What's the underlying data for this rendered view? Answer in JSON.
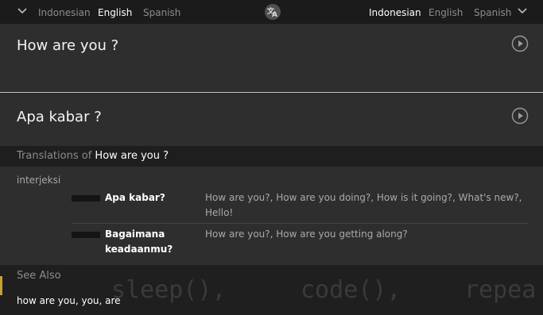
{
  "source_languages": [
    "Indonesian",
    "English",
    "Spanish"
  ],
  "source_active": "English",
  "target_languages": [
    "Indonesian",
    "English",
    "Spanish"
  ],
  "target_active": "Indonesian",
  "source_phrase": "How are you ?",
  "target_phrase": "Apa kabar ?",
  "translations_header": {
    "prefix": "Translations of",
    "term": "How are you ?"
  },
  "part_of_speech": "interjeksi",
  "translations": [
    {
      "word": "Apa kabar?",
      "synonyms": "How are you?, How are you doing?, How is it going?, What's new?, Hello!"
    },
    {
      "word": "Bagaimana keadaanmu?",
      "synonyms": "How are you?, How are you getting along?"
    }
  ],
  "see_also": {
    "label": "See Also",
    "items": "how are you, you, are"
  },
  "background_code": [
    "sleep(),",
    "code(),",
    "repea"
  ],
  "icons": {
    "source_lang_dropdown": "chevron-down-icon",
    "target_lang_dropdown": "chevron-down-icon",
    "swap": "translate-swap-icon",
    "play_source": "play-icon",
    "play_target": "play-icon"
  }
}
